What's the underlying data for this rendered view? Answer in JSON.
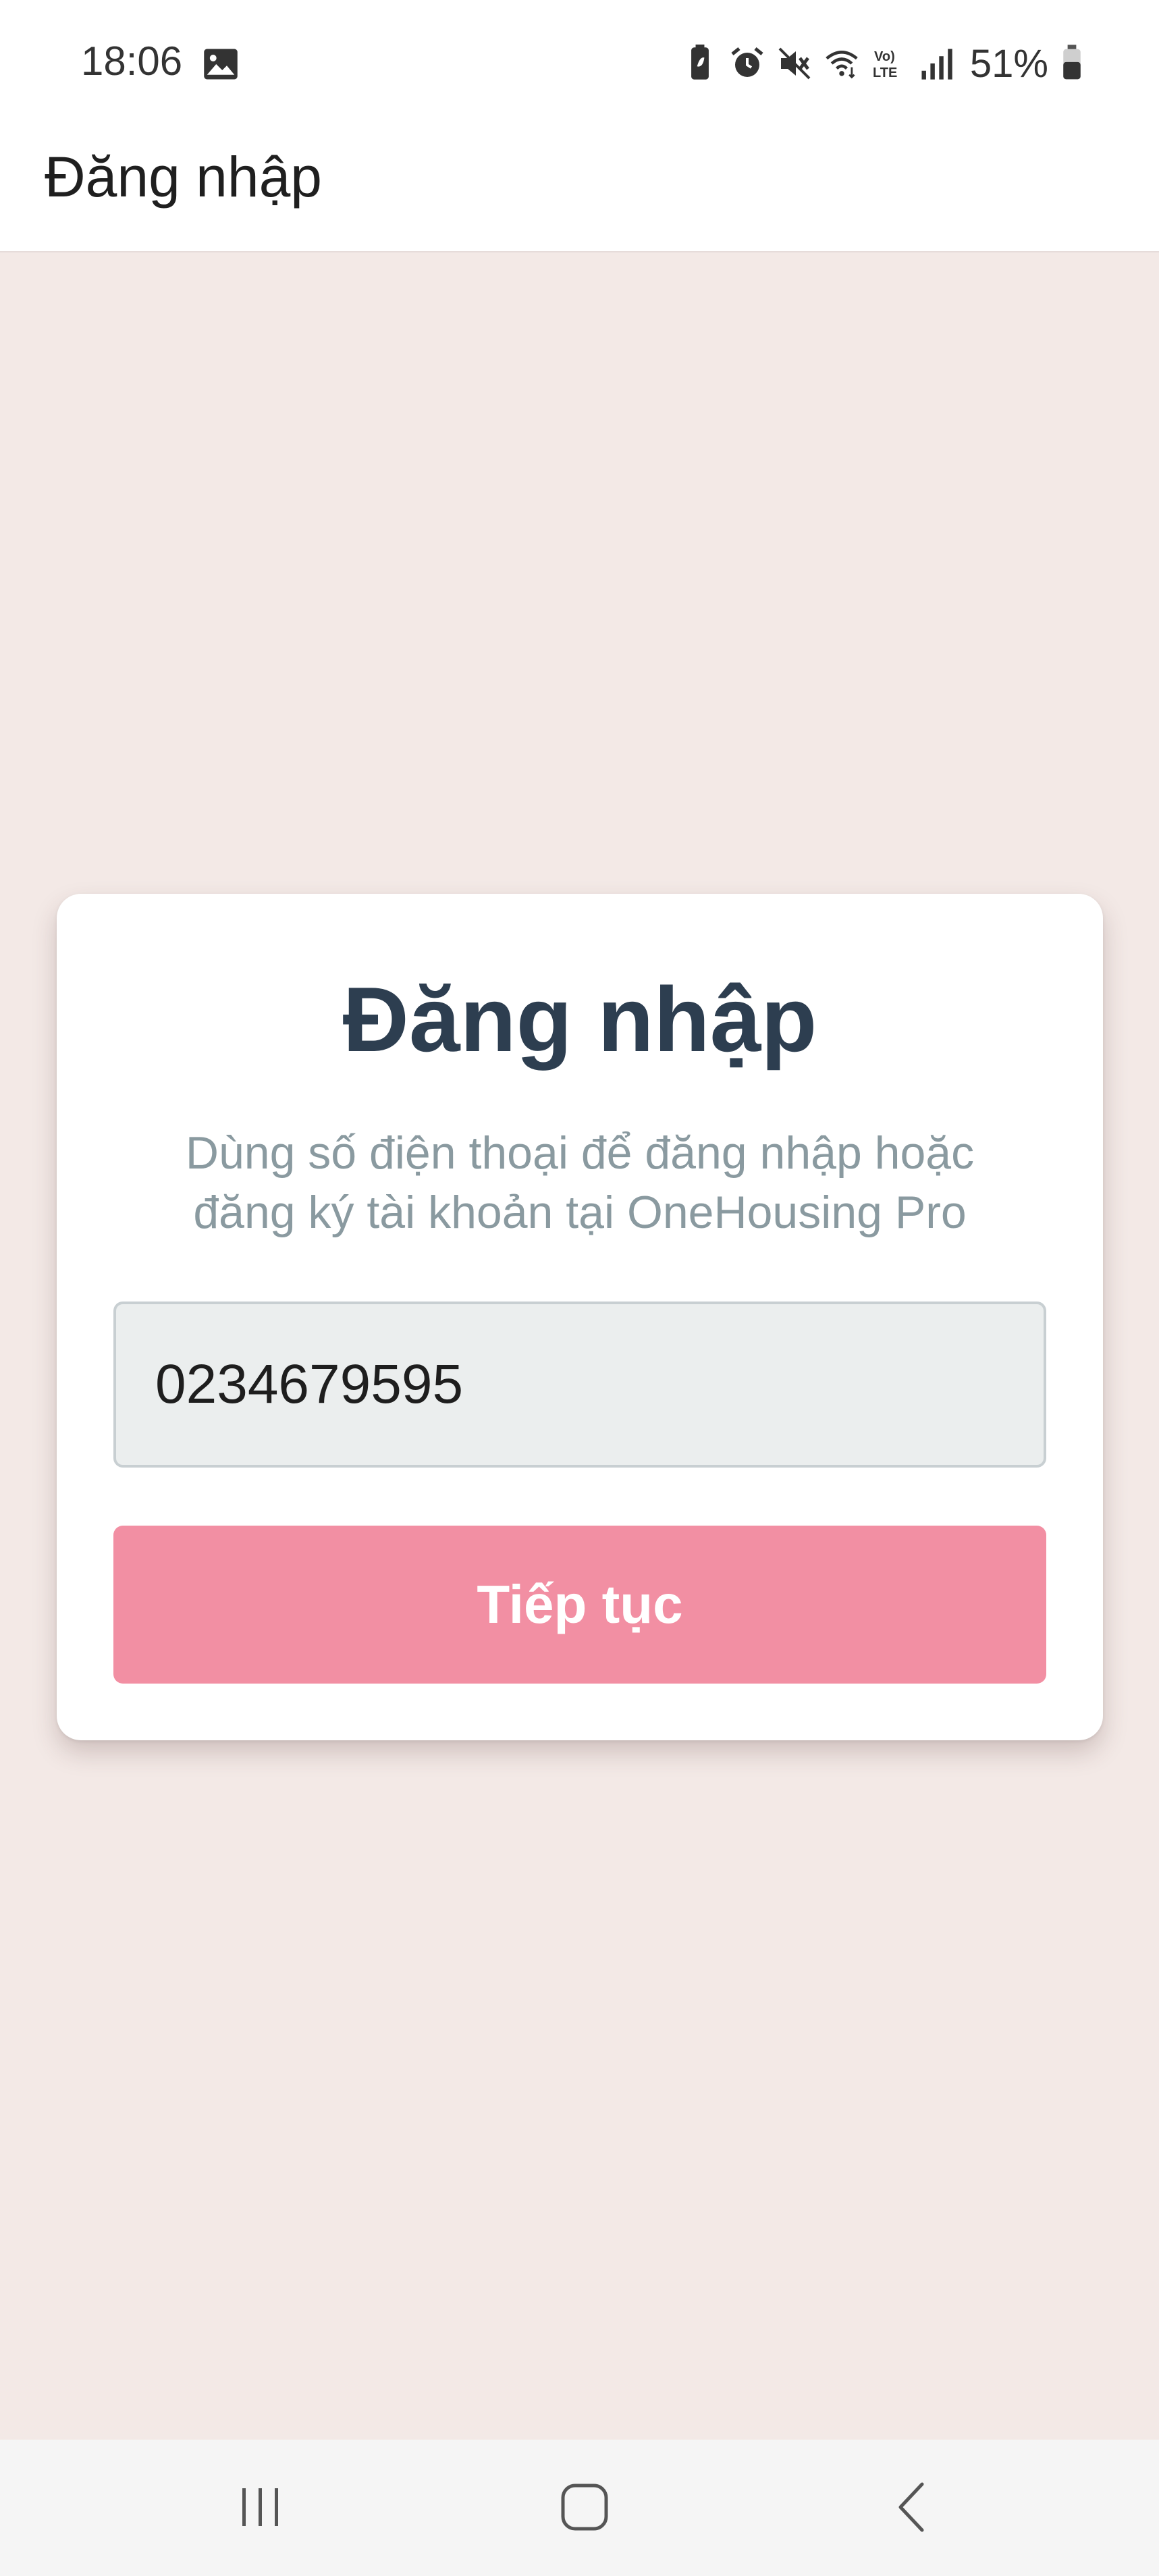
{
  "status_bar": {
    "time": "18:06",
    "battery_percent": "51%",
    "icons": [
      "image-icon",
      "battery-saver-icon",
      "alarm-icon",
      "mute-icon",
      "wifi-icon",
      "volte-icon",
      "signal-icon",
      "battery-icon"
    ]
  },
  "app_bar": {
    "title": "Đăng nhập"
  },
  "login_card": {
    "title": "Đăng nhập",
    "subtitle_line1": "Dùng số điện thoại để đăng nhập hoặc",
    "subtitle_line2": "đăng ký tài khoản tại OneHousing Pro",
    "phone_value": "0234679595",
    "continue_label": "Tiếp tục"
  },
  "colors": {
    "background": "#f3e9e6",
    "title_color": "#2d3e50",
    "button_color": "#f28fa3",
    "input_background": "#ebeeee"
  },
  "nav_bar": {
    "icons": [
      "recents-icon",
      "home-icon",
      "back-icon"
    ]
  }
}
